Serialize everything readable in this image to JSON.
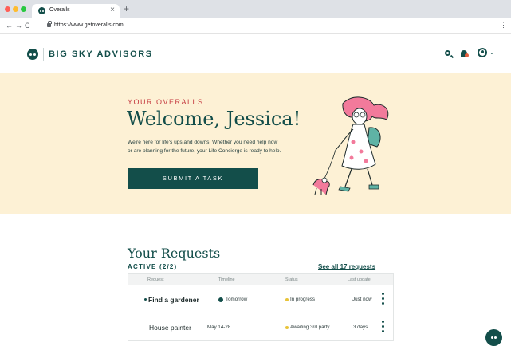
{
  "browser": {
    "tab_title": "Overalls",
    "tab_close": "×",
    "new_tab": "+",
    "url": "https://www.getoveralls.com",
    "back": "←",
    "forward": "→",
    "reload": "C",
    "menu": "⋮"
  },
  "header": {
    "brand": "BIG SKY ADVISORS",
    "icons": [
      "search-icon",
      "bell-icon",
      "user-icon",
      "chevron-down-icon"
    ],
    "chevron": "⌄"
  },
  "hero": {
    "eyebrow": "YOUR OVERALLS",
    "welcome": "Welcome, Jessica!",
    "blurb_line1": "We're here for life's ups and downs. Whether you need help now",
    "blurb_line2": "or are planning for the future, your Life Concierge is ready to help.",
    "submit_label": "SUBMIT A TASK"
  },
  "requests": {
    "title": "Your Requests",
    "active_label": "ACTIVE (2/2)",
    "see_all": "See all 17 requests",
    "columns": [
      "Request",
      "Timeline",
      "Status",
      "Last update"
    ],
    "rows": [
      {
        "request": "Find a gardener",
        "timeline": "Tomorrow",
        "status": "In progress",
        "last_update": "Just now",
        "unread": true
      },
      {
        "request": "House painter",
        "timeline": "May 14-28",
        "status": "Awaiting 3rd party",
        "last_update": "3 days",
        "unread": false
      }
    ]
  },
  "colors": {
    "brand_teal": "#134e4a",
    "hero_bg": "#fdf1d5",
    "eyebrow_red": "#c4383e",
    "status_yellow": "#e8c43a",
    "illustration_pink": "#f27a9b"
  }
}
